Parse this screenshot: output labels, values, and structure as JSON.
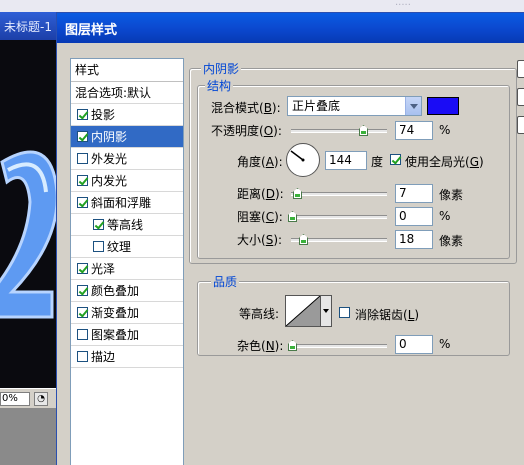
{
  "window": {
    "doc_tab_title": "未标题-1",
    "zoom": "0%",
    "top_text": "....."
  },
  "dialog": {
    "title": "图层样式"
  },
  "sidebar": {
    "header": "样式",
    "blend_options": "混合选项:默认",
    "items": [
      {
        "label": "投影",
        "checked": true,
        "active": false,
        "indent": false
      },
      {
        "label": "内阴影",
        "checked": true,
        "active": true,
        "indent": false
      },
      {
        "label": "外发光",
        "checked": false,
        "active": false,
        "indent": false
      },
      {
        "label": "内发光",
        "checked": true,
        "active": false,
        "indent": false
      },
      {
        "label": "斜面和浮雕",
        "checked": true,
        "active": false,
        "indent": false
      },
      {
        "label": "等高线",
        "checked": true,
        "active": false,
        "indent": true
      },
      {
        "label": "纹理",
        "checked": false,
        "active": false,
        "indent": true
      },
      {
        "label": "光泽",
        "checked": true,
        "active": false,
        "indent": false
      },
      {
        "label": "颜色叠加",
        "checked": true,
        "active": false,
        "indent": false
      },
      {
        "label": "渐变叠加",
        "checked": true,
        "active": false,
        "indent": false
      },
      {
        "label": "图案叠加",
        "checked": false,
        "active": false,
        "indent": false
      },
      {
        "label": "描边",
        "checked": false,
        "active": false,
        "indent": false
      }
    ]
  },
  "inner_shadow": {
    "section_title": "内阴影",
    "structure_title": "结构",
    "blend_mode_label": "混合模式(",
    "blend_mode_key": "B",
    "blend_mode_value": "正片叠底",
    "color": "#1a0cf5",
    "opacity_label": "不透明度(",
    "opacity_key": "O",
    "opacity_value": "74",
    "opacity_unit": "%",
    "angle_label": "角度(",
    "angle_key": "A",
    "angle_value": "144",
    "angle_unit": "度",
    "global_light_label": "使用全局光(",
    "global_light_key": "G",
    "global_light_checked": true,
    "distance_label": "距离(",
    "distance_key": "D",
    "distance_value": "7",
    "distance_unit": "像素",
    "choke_label": "阻塞(",
    "choke_key": "C",
    "choke_value": "0",
    "choke_unit": "%",
    "size_label": "大小(",
    "size_key": "S",
    "size_value": "18",
    "size_unit": "像素",
    "close_paren": ")",
    "close_paren_colon": "):"
  },
  "quality": {
    "title": "品质",
    "contour_label": "等高线:",
    "antialias_label": "消除锯齿(",
    "antialias_key": "L",
    "antialias_checked": false,
    "noise_label": "杂色(",
    "noise_key": "N",
    "noise_value": "0",
    "noise_unit": "%"
  }
}
